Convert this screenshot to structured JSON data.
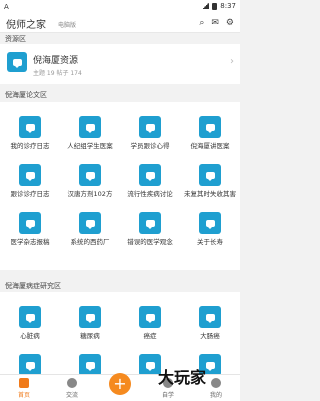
{
  "statusbar": {
    "left": "A",
    "time": "8:37"
  },
  "appbar": {
    "title": "倪师之家",
    "subtitle": "电脑版"
  },
  "resources": {
    "section": "资源区",
    "name": "倪海厦资源",
    "meta": "主题 19  帖子 174"
  },
  "lunwen": {
    "section": "倪海厦论文区",
    "items": [
      {
        "label": "我的诊疗日志"
      },
      {
        "label": "人纪组学生医案"
      },
      {
        "label": "学员跟诊心得"
      },
      {
        "label": "倪海厦讲医案"
      },
      {
        "label": "跟诊诊疗日志"
      },
      {
        "label": "汉唐方剂102方"
      },
      {
        "label": "流行性疾病讨论"
      },
      {
        "label": "未复其时失收其害"
      },
      {
        "label": "医学杂志报稿"
      },
      {
        "label": "系统的西药厂"
      },
      {
        "label": "错误的医学观念"
      },
      {
        "label": "关于长寿"
      }
    ]
  },
  "bingzheng": {
    "section": "倪海厦病症研究区",
    "items": [
      {
        "label": "心脏病"
      },
      {
        "label": "糖尿病"
      },
      {
        "label": "癌症"
      },
      {
        "label": "大肠癌"
      }
    ]
  },
  "tabs": [
    {
      "label": "首页"
    },
    {
      "label": "交流"
    },
    {
      "label": "自学"
    },
    {
      "label": "我的"
    }
  ],
  "watermark": "大玩家",
  "colors": {
    "accent": "#f07a1a",
    "icon_blue": "#1f9fd0"
  }
}
